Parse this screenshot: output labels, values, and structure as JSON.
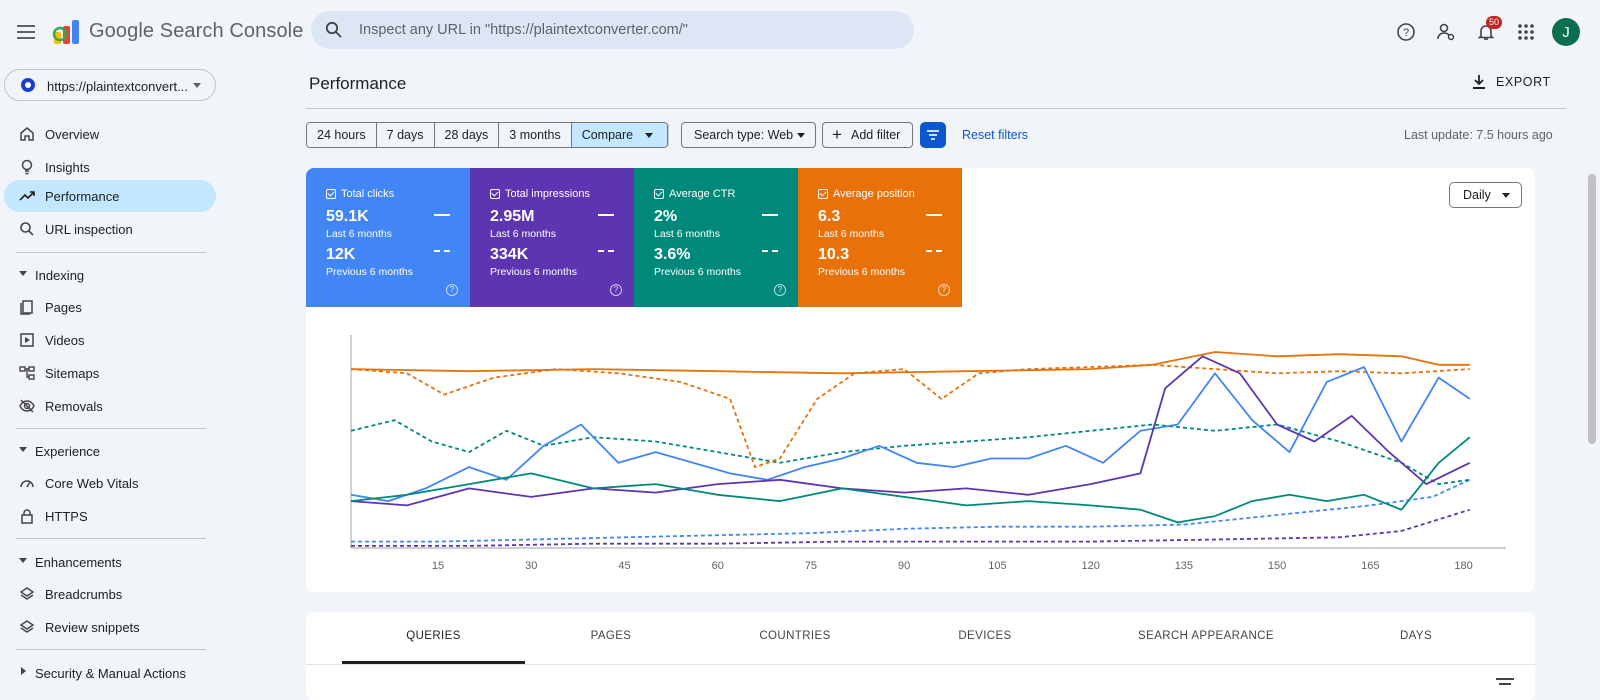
{
  "app": {
    "title": "Google Search Console",
    "avatar_initial": "J",
    "notification_count": "50"
  },
  "search": {
    "placeholder": "Inspect any URL in \"https://plaintextconverter.com/\""
  },
  "property": {
    "label": "https://plaintextconvert..."
  },
  "sidebar": {
    "top_items": [
      {
        "label": "Overview",
        "icon": "home-icon"
      },
      {
        "label": "Insights",
        "icon": "lightbulb-icon"
      },
      {
        "label": "Performance",
        "icon": "trending-up-icon",
        "active": true
      },
      {
        "label": "URL inspection",
        "icon": "search-icon"
      }
    ],
    "indexing": {
      "label": "Indexing",
      "items": [
        {
          "label": "Pages",
          "icon": "pages-icon"
        },
        {
          "label": "Videos",
          "icon": "video-icon"
        },
        {
          "label": "Sitemaps",
          "icon": "sitemap-icon"
        },
        {
          "label": "Removals",
          "icon": "eye-off-icon"
        }
      ]
    },
    "experience": {
      "label": "Experience",
      "items": [
        {
          "label": "Core Web Vitals",
          "icon": "speedometer-icon"
        },
        {
          "label": "HTTPS",
          "icon": "lock-icon"
        }
      ]
    },
    "enhancements": {
      "label": "Enhancements",
      "items": [
        {
          "label": "Breadcrumbs",
          "icon": "layers-icon"
        },
        {
          "label": "Review snippets",
          "icon": "layers-icon"
        }
      ]
    },
    "security": {
      "label": "Security & Manual Actions"
    }
  },
  "main": {
    "title": "Performance",
    "export_label": "EXPORT",
    "date_ranges": [
      "24 hours",
      "7 days",
      "28 days",
      "3 months",
      "Compare"
    ],
    "search_type": "Search type: Web",
    "add_filter": "Add filter",
    "reset_filters": "Reset filters",
    "last_update": "Last update: 7.5 hours ago",
    "granularity": "Daily",
    "metrics": [
      {
        "name": "Total clicks",
        "value": "59.1K",
        "period": "Last 6 months",
        "prev_value": "12K",
        "prev_period": "Previous 6 months",
        "color": "#4285f4"
      },
      {
        "name": "Total impressions",
        "value": "2.95M",
        "period": "Last 6 months",
        "prev_value": "334K",
        "prev_period": "Previous 6 months",
        "color": "#5e35b1"
      },
      {
        "name": "Average CTR",
        "value": "2%",
        "period": "Last 6 months",
        "prev_value": "3.6%",
        "prev_period": "Previous 6 months",
        "color": "#00897b"
      },
      {
        "name": "Average position",
        "value": "6.3",
        "period": "Last 6 months",
        "prev_value": "10.3",
        "prev_period": "Previous 6 months",
        "color": "#e8710a"
      }
    ],
    "tabs": [
      "QUERIES",
      "PAGES",
      "COUNTRIES",
      "DEVICES",
      "SEARCH APPEARANCE",
      "DAYS"
    ]
  },
  "chart_data": {
    "type": "line",
    "xlabel": "",
    "ylabel": "",
    "x_ticks": [
      15,
      30,
      45,
      60,
      75,
      90,
      105,
      120,
      135,
      150,
      165,
      180
    ],
    "x_range": [
      1,
      182
    ],
    "y_range": [
      0,
      100
    ],
    "grid": false,
    "series": [
      {
        "name": "Total clicks",
        "style": "solid",
        "color": "#4285f4",
        "points": [
          [
            1,
            25
          ],
          [
            7,
            22
          ],
          [
            13,
            28
          ],
          [
            20,
            38
          ],
          [
            26,
            32
          ],
          [
            32,
            48
          ],
          [
            38,
            58
          ],
          [
            44,
            40
          ],
          [
            50,
            45
          ],
          [
            56,
            40
          ],
          [
            62,
            35
          ],
          [
            68,
            32
          ],
          [
            74,
            38
          ],
          [
            80,
            42
          ],
          [
            86,
            48
          ],
          [
            92,
            40
          ],
          [
            98,
            38
          ],
          [
            104,
            42
          ],
          [
            110,
            42
          ],
          [
            116,
            48
          ],
          [
            122,
            40
          ],
          [
            128,
            55
          ],
          [
            134,
            58
          ],
          [
            140,
            82
          ],
          [
            146,
            60
          ],
          [
            152,
            45
          ],
          [
            158,
            78
          ],
          [
            164,
            85
          ],
          [
            170,
            50
          ],
          [
            176,
            80
          ],
          [
            181,
            70
          ]
        ]
      },
      {
        "name": "Total clicks",
        "style": "dashed",
        "color": "#4285f4",
        "points": [
          [
            1,
            3
          ],
          [
            15,
            3
          ],
          [
            30,
            4
          ],
          [
            45,
            5
          ],
          [
            60,
            6
          ],
          [
            75,
            7
          ],
          [
            90,
            9
          ],
          [
            105,
            10
          ],
          [
            120,
            10
          ],
          [
            135,
            11
          ],
          [
            145,
            14
          ],
          [
            155,
            17
          ],
          [
            165,
            20
          ],
          [
            175,
            24
          ],
          [
            181,
            32
          ]
        ]
      },
      {
        "name": "Total impressions",
        "style": "solid",
        "color": "#5e35b1",
        "points": [
          [
            1,
            22
          ],
          [
            10,
            20
          ],
          [
            20,
            28
          ],
          [
            30,
            24
          ],
          [
            40,
            28
          ],
          [
            50,
            26
          ],
          [
            60,
            30
          ],
          [
            70,
            32
          ],
          [
            80,
            28
          ],
          [
            90,
            26
          ],
          [
            100,
            28
          ],
          [
            110,
            25
          ],
          [
            120,
            30
          ],
          [
            128,
            35
          ],
          [
            132,
            75
          ],
          [
            138,
            90
          ],
          [
            144,
            82
          ],
          [
            150,
            58
          ],
          [
            156,
            50
          ],
          [
            162,
            62
          ],
          [
            168,
            45
          ],
          [
            174,
            30
          ],
          [
            181,
            40
          ]
        ]
      },
      {
        "name": "Total impressions",
        "style": "dashed",
        "color": "#5e35b1",
        "points": [
          [
            1,
            1
          ],
          [
            20,
            1
          ],
          [
            40,
            2
          ],
          [
            60,
            2
          ],
          [
            80,
            3
          ],
          [
            100,
            3
          ],
          [
            120,
            3
          ],
          [
            140,
            4
          ],
          [
            160,
            5
          ],
          [
            170,
            8
          ],
          [
            181,
            18
          ]
        ]
      },
      {
        "name": "Average CTR",
        "style": "solid",
        "color": "#00897b",
        "points": [
          [
            1,
            22
          ],
          [
            10,
            25
          ],
          [
            20,
            30
          ],
          [
            30,
            35
          ],
          [
            40,
            28
          ],
          [
            50,
            30
          ],
          [
            60,
            25
          ],
          [
            70,
            22
          ],
          [
            80,
            28
          ],
          [
            90,
            24
          ],
          [
            100,
            20
          ],
          [
            110,
            22
          ],
          [
            120,
            20
          ],
          [
            128,
            18
          ],
          [
            134,
            12
          ],
          [
            140,
            15
          ],
          [
            146,
            22
          ],
          [
            152,
            25
          ],
          [
            158,
            22
          ],
          [
            164,
            25
          ],
          [
            170,
            18
          ],
          [
            176,
            40
          ],
          [
            181,
            52
          ]
        ]
      },
      {
        "name": "Average CTR",
        "style": "dashed",
        "color": "#00897b",
        "points": [
          [
            1,
            55
          ],
          [
            8,
            60
          ],
          [
            14,
            50
          ],
          [
            20,
            45
          ],
          [
            26,
            55
          ],
          [
            32,
            48
          ],
          [
            40,
            52
          ],
          [
            50,
            50
          ],
          [
            60,
            45
          ],
          [
            70,
            40
          ],
          [
            80,
            45
          ],
          [
            90,
            48
          ],
          [
            100,
            50
          ],
          [
            110,
            52
          ],
          [
            120,
            55
          ],
          [
            130,
            58
          ],
          [
            140,
            55
          ],
          [
            150,
            58
          ],
          [
            160,
            50
          ],
          [
            170,
            40
          ],
          [
            176,
            30
          ],
          [
            181,
            32
          ]
        ]
      },
      {
        "name": "Average position",
        "style": "solid",
        "color": "#e8710a",
        "points": [
          [
            1,
            84
          ],
          [
            20,
            83
          ],
          [
            40,
            84
          ],
          [
            60,
            83
          ],
          [
            80,
            82
          ],
          [
            100,
            83
          ],
          [
            120,
            84
          ],
          [
            130,
            86
          ],
          [
            140,
            92
          ],
          [
            150,
            90
          ],
          [
            160,
            91
          ],
          [
            170,
            90
          ],
          [
            176,
            86
          ],
          [
            181,
            86
          ]
        ]
      },
      {
        "name": "Average position",
        "style": "dashed",
        "color": "#e8710a",
        "points": [
          [
            1,
            84
          ],
          [
            10,
            82
          ],
          [
            16,
            72
          ],
          [
            24,
            80
          ],
          [
            34,
            84
          ],
          [
            44,
            82
          ],
          [
            54,
            78
          ],
          [
            62,
            70
          ],
          [
            66,
            38
          ],
          [
            70,
            42
          ],
          [
            76,
            70
          ],
          [
            82,
            82
          ],
          [
            90,
            84
          ],
          [
            96,
            70
          ],
          [
            102,
            82
          ],
          [
            110,
            84
          ],
          [
            120,
            85
          ],
          [
            130,
            86
          ],
          [
            140,
            84
          ],
          [
            150,
            82
          ],
          [
            160,
            83
          ],
          [
            170,
            82
          ],
          [
            181,
            84
          ]
        ]
      }
    ]
  }
}
